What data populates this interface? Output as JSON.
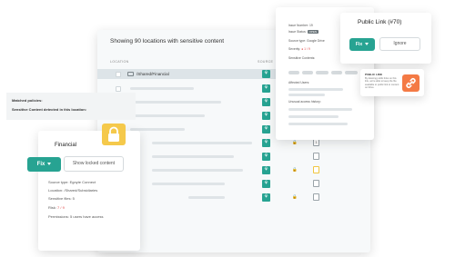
{
  "main": {
    "header": "Showing 90 locations with sensitive content",
    "col_location": "LOCATION",
    "col_source": "SOURCE",
    "selected_row": "/Shared/Financial",
    "mini_box_label": "1"
  },
  "detail": {
    "issue_number_label": "Issue Number:",
    "issue_number": "19",
    "issue_status_label": "Issue Status:",
    "issue_status": "OPEN",
    "source_type_label": "Source type:",
    "source_type": "Google Drive",
    "severity_label": "Severity:",
    "severity": "● 1 / 9",
    "sensitive_contents_label": "Sensitive Contents:",
    "affected_users_label": "Affected Users:",
    "unusual_access_label": "Unusual access history:"
  },
  "public_link": {
    "title": "Public Link (#70)",
    "fix": "Fix",
    "ignore": "Ignore"
  },
  "tooltip": {
    "title": "PUBLIC LINK",
    "body": "By deleting public links on this link, we're able to keep the file available to public link to content on Drive."
  },
  "locked": {
    "title": "Financial",
    "fix": "Fix",
    "show_locked": "Show locked content",
    "source_type": "Source type: Egnyte Connect",
    "location": "Location: /Shared/Subsidiaries",
    "sensitive_files": "Sensitive files:  5",
    "risk_label": "Risk:",
    "risk_value": "7 / 9",
    "permissions": "Permissions: 5 users have access",
    "matched_policies": "Matched policies:",
    "sensitive_detected": "Sensitive Content detected in this location:"
  },
  "colors": {
    "accent": "#27a392",
    "link_tile": "#f47a45",
    "lock_tile": "#f5c94b",
    "risk": "#e04b4b"
  },
  "icons": [
    "folder-icon",
    "source-icon",
    "lock-icon",
    "link-icon",
    "chevron-down-icon",
    "file-icon"
  ]
}
